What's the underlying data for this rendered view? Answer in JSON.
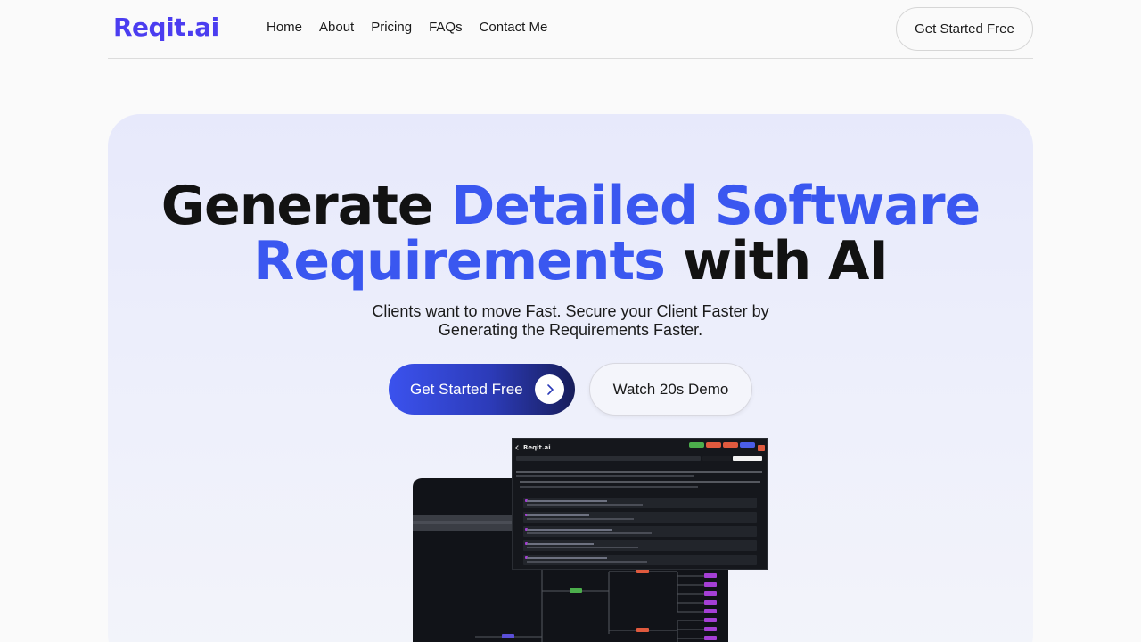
{
  "nav": {
    "logo": "Reqit.ai",
    "links": [
      "Home",
      "About",
      "Pricing",
      "FAQs",
      "Contact Me"
    ],
    "cta": "Get Started Free"
  },
  "hero": {
    "headline_part1": "Generate ",
    "headline_highlight1": "Detailed Software",
    "headline_highlight2": "Requirements",
    "headline_part2": " with AI",
    "subtitle_line1": "Clients want to move Fast. Secure your Client Faster by",
    "subtitle_line2": "Generating the Requirements Faster.",
    "primary_button": "Get Started Free",
    "secondary_button": "Watch 20s Demo"
  },
  "preview": {
    "app_title": "Reqit.ai"
  },
  "colors": {
    "brand": "#4b3df0",
    "highlight": "#3a57f0",
    "button_gradient_start": "#3b52ee",
    "button_gradient_end": "#171d5a"
  }
}
